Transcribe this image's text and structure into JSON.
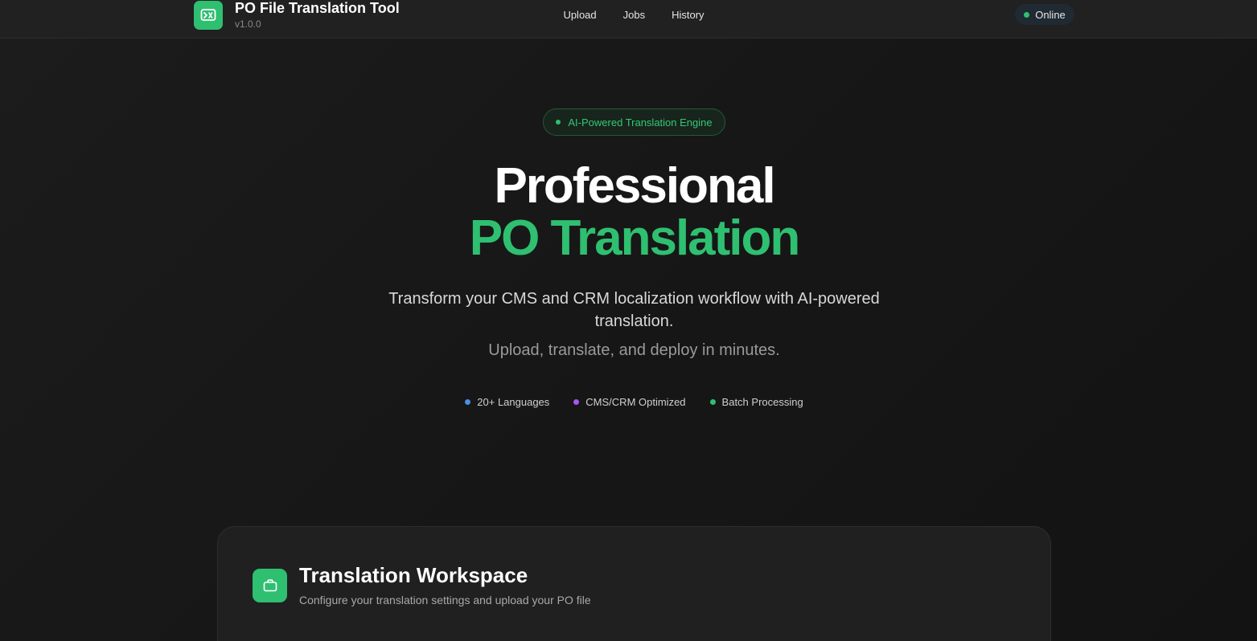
{
  "header": {
    "title": "PO File Translation Tool",
    "version": "v1.0.0",
    "logo_icon": "translate-icon",
    "nav": [
      {
        "label": "Upload"
      },
      {
        "label": "Jobs"
      },
      {
        "label": "History"
      }
    ],
    "status": {
      "label": "Online",
      "color": "#2fbf71"
    }
  },
  "hero": {
    "badge": "AI-Powered Translation Engine",
    "title_line1": "Professional",
    "title_line2": "PO Translation",
    "description": "Transform your CMS and CRM localization workflow with AI-powered translation.",
    "subtitle": "Upload, translate, and deploy in minutes.",
    "features": [
      {
        "label": "20+ Languages",
        "color": "#4a90e2"
      },
      {
        "label": "CMS/CRM Optimized",
        "color": "#a855f7"
      },
      {
        "label": "Batch Processing",
        "color": "#2fbf71"
      }
    ]
  },
  "workspace": {
    "icon": "briefcase-icon",
    "title": "Translation Workspace",
    "subtitle": "Configure your translation settings and upload your PO file"
  },
  "colors": {
    "accent": "#2fbf71",
    "background": "#151515",
    "header": "#212121",
    "card": "#202020"
  }
}
